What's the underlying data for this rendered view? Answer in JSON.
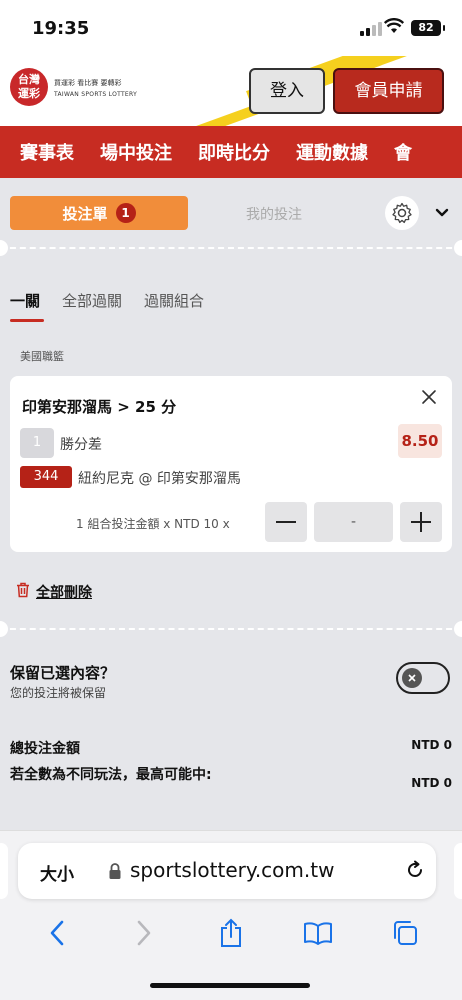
{
  "status_bar": {
    "time": "19:35",
    "battery": "82"
  },
  "header": {
    "logo_line1": "台灣",
    "logo_line2": "運彩",
    "logo_tagline": "買運彩 看比賽 要轉彩",
    "logo_en": "TAIWAN SPORTS LOTTERY",
    "login_label": "登入",
    "register_label": "會員申請"
  },
  "nav": {
    "items": [
      "賽事表",
      "場中投注",
      "即時比分",
      "運動數據",
      "會"
    ]
  },
  "betslip": {
    "tab_slip_label": "投注單",
    "tab_slip_count": "1",
    "tab_mybets_label": "我的投注",
    "subtabs": [
      "一關",
      "全部過關",
      "過關組合"
    ],
    "league": "美國職籃",
    "selection": "印第安那溜馬 > 25 分",
    "market_number": "1",
    "market": "勝分差",
    "odds": "8.50",
    "game_code": "344",
    "match": "紐約尼克 @ 印第安那溜馬",
    "stake_label": "1 組合投注金額 x NTD 10 x",
    "stake_value": "-",
    "delete_all": "全部刪除",
    "keep_title": "保留已選內容？",
    "keep_sub": "您的投注將被保留",
    "total_label": "總投注金額",
    "total_value": "NTD 0",
    "max_label": "若全數為不同玩法，最高可能中:",
    "max_value": "NTD 0"
  },
  "browser": {
    "text_size": "大小",
    "domain": "sportslottery.com.tw"
  },
  "colors": {
    "brand_red": "#c72c22",
    "orange": "#f18d3a",
    "yellow": "#f5d01e"
  }
}
